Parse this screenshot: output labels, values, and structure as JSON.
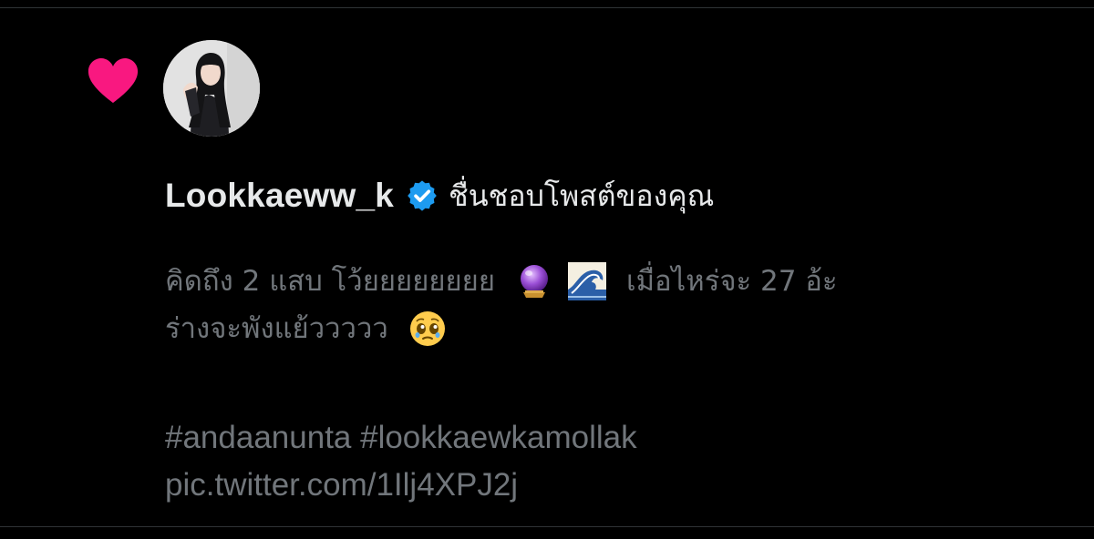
{
  "notification": {
    "username": "Lookkaeww_k",
    "action": "ชื่นชอบโพสต์ของคุณ",
    "tweet": {
      "line1_a": "คิดถึง 2 แสบ โว้ยยยยยยยย",
      "line1_b": "เมื่อไหร่จะ 27 อ้ะ",
      "line2": "ร่างจะพังแย้ววววว",
      "hashtags": "#andaanunta #lookkaewkamollak",
      "link": "pic.twitter.com/1Ilj4XPJ2j"
    },
    "icons": {
      "like": "heart-icon",
      "verified": "verified-badge-icon",
      "emoji1": "crystal-ball-emoji",
      "emoji2": "water-wave-emoji",
      "emoji3": "pleading-face-emoji"
    }
  },
  "colors": {
    "background": "#000000",
    "heart": "#f91880",
    "verified": "#1d9bf0",
    "primary_text": "#e7e9ea",
    "secondary_text": "#71767b"
  }
}
